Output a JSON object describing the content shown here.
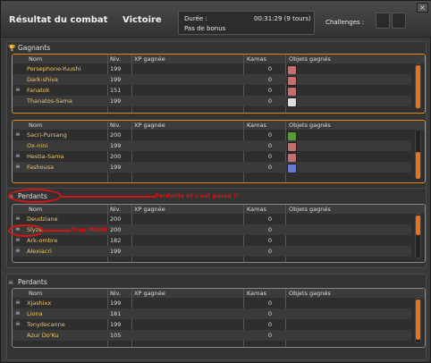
{
  "header": {
    "title": "Résultat du combat",
    "result": "Victoire",
    "duration_label": "Durée :",
    "duration_value": "00:31:29 (9 tours)",
    "bonus": "Pas de bonus",
    "challenges_label": "Challenges :"
  },
  "columns": {
    "name": "Nom",
    "level": "Niv.",
    "xp": "XP gagnée",
    "kamas": "Kamas",
    "items": "Objets gagnés"
  },
  "winners": {
    "title": "Gagnants",
    "group1": [
      {
        "name": "Persephone-Yuushi",
        "level": "199",
        "kamas": "0",
        "items": [
          "#c0392b",
          "#6aa0c0",
          "#7ab07a",
          "#c07070"
        ]
      },
      {
        "name": "Dark-shiva",
        "level": "199",
        "kamas": "0",
        "items": [
          "#d05020",
          "#5a9a3a",
          "#6aa0c0",
          "#ddd",
          "#8a9a8a",
          "#c07070"
        ]
      },
      {
        "name": "Fanatok",
        "level": "151",
        "kamas": "0",
        "items": [
          "#6aa0c0",
          "#7ab07a",
          "#ddd",
          "#8a9a8a",
          "#c07070"
        ]
      },
      {
        "name": "Thanatos-Sama",
        "level": "199",
        "kamas": "0",
        "items": [
          "#5a8a3a",
          "#ddd"
        ]
      }
    ],
    "group2": [
      {
        "name": "Sacri-Pursang",
        "level": "200",
        "kamas": "0",
        "items": [
          "#6aa0c0",
          "#7ab07a",
          "#8a9a8a",
          "#5a9a3a"
        ]
      },
      {
        "name": "Ox-nini",
        "level": "199",
        "kamas": "0",
        "items": [
          "#6aa0c0",
          "#7ab07a",
          "#8a9a8a",
          "#c07070"
        ]
      },
      {
        "name": "Hestia-Sama",
        "level": "200",
        "kamas": "0",
        "items": [
          "#6aa0c0",
          "#7ab07a",
          "#8a9a8a",
          "#c07070"
        ]
      },
      {
        "name": "Fashousa",
        "level": "199",
        "kamas": "0",
        "items": [
          "#6a7ad0"
        ]
      }
    ]
  },
  "losers1": {
    "title": "Perdants",
    "rows": [
      {
        "name": "Deudziane",
        "level": "200",
        "kamas": "0"
      },
      {
        "name": "Slyze",
        "level": "200",
        "kamas": "0"
      },
      {
        "name": "Ark-ombre",
        "level": "182",
        "kamas": "0"
      },
      {
        "name": "Alexiacri",
        "level": "199",
        "kamas": "0"
      }
    ]
  },
  "losers2": {
    "title": "Perdants",
    "rows": [
      {
        "name": "Xjashixx",
        "level": "199",
        "kamas": "0"
      },
      {
        "name": "Liona",
        "level": "181",
        "kamas": "0"
      },
      {
        "name": "Tonydecanne",
        "level": "199",
        "kamas": "0"
      },
      {
        "name": "Azur Do'Ku",
        "level": "105",
        "kamas": "0"
      }
    ]
  },
  "annotations": {
    "losers_note": "Perdants et c'est passé !!",
    "slyze_note": "Trop MDRR"
  },
  "colors": {
    "accent": "#e8891f",
    "annotation": "#d41515",
    "name": "#f2c56a"
  }
}
